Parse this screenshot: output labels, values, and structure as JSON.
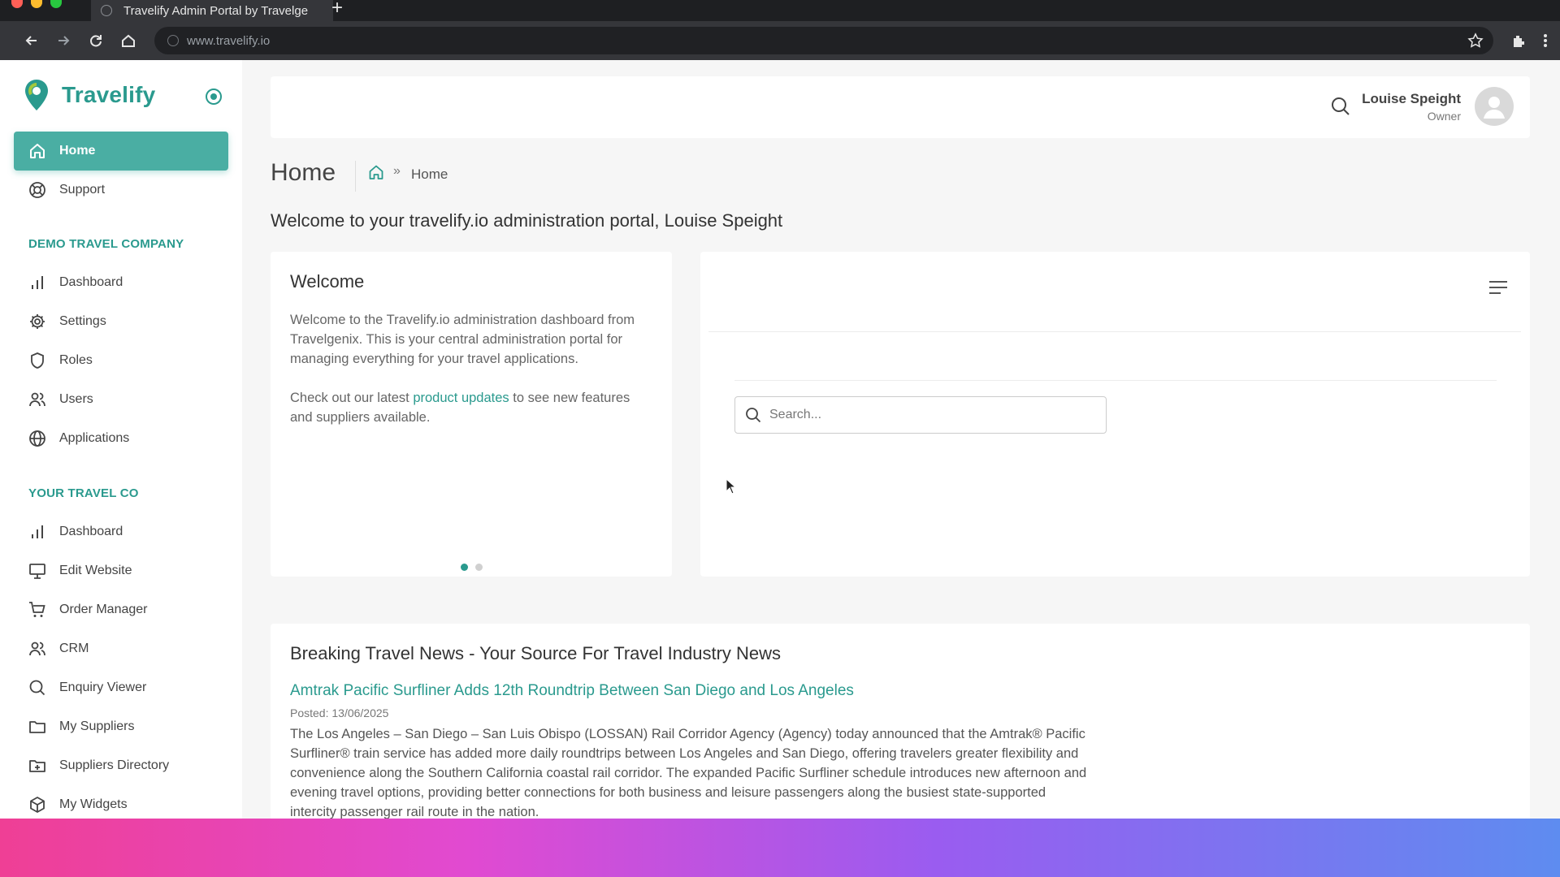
{
  "browser": {
    "tab_title": "Travelify Admin Portal by Travelge",
    "new_tab": "+",
    "url": "www.travelify.io"
  },
  "app": {
    "logo_text": "Travelify",
    "accent_color": "#2a9a8e"
  },
  "sidebar": {
    "top_items": [
      {
        "label": "Home",
        "icon": "home-icon",
        "active": true
      },
      {
        "label": "Support",
        "icon": "lifebuoy-icon"
      }
    ],
    "section1_title": "DEMO TRAVEL COMPANY",
    "section1_items": [
      {
        "label": "Dashboard",
        "icon": "bar-chart-icon"
      },
      {
        "label": "Settings",
        "icon": "gear-icon"
      },
      {
        "label": "Roles",
        "icon": "shield-icon"
      },
      {
        "label": "Users",
        "icon": "users-icon"
      },
      {
        "label": "Applications",
        "icon": "globe-icon"
      }
    ],
    "section2_title": "YOUR TRAVEL CO",
    "section2_items": [
      {
        "label": "Dashboard",
        "icon": "bar-chart-icon"
      },
      {
        "label": "Edit Website",
        "icon": "monitor-icon"
      },
      {
        "label": "Order Manager",
        "icon": "cart-icon"
      },
      {
        "label": "CRM",
        "icon": "users-icon"
      },
      {
        "label": "Enquiry Viewer",
        "icon": "search-icon"
      },
      {
        "label": "My Suppliers",
        "icon": "folder-icon"
      },
      {
        "label": "Suppliers Directory",
        "icon": "folder-plus-icon"
      },
      {
        "label": "My Widgets",
        "icon": "cube-icon"
      }
    ]
  },
  "header": {
    "user_name": "Louise Speight",
    "user_role": "Owner"
  },
  "page": {
    "title": "Home",
    "breadcrumb_sep": "»",
    "breadcrumb_current": "Home",
    "welcome_line": "Welcome to your travelify.io administration portal, Louise Speight"
  },
  "welcome_card": {
    "title": "Welcome",
    "p1": "Welcome to the Travelify.io administration dashboard from Travelgenix. This is your central administration portal for managing everything for your travel applications.",
    "p2_before": "Check out our latest ",
    "p2_link": "product updates",
    "p2_after": " to see new features and suppliers available."
  },
  "search": {
    "placeholder": "Search..."
  },
  "news": {
    "title": "Breaking Travel News - Your Source For Travel Industry News",
    "headline": "Amtrak Pacific Surfliner Adds 12th Roundtrip Between San Diego and Los Angeles",
    "posted": "Posted: 13/06/2025",
    "body": "The Los Angeles – San Diego – San Luis Obispo (LOSSAN) Rail Corridor Agency (Agency) today announced that the Amtrak® Pacific Surfliner® train service has added more daily roundtrips between Los Angeles and San Diego, offering travelers greater flexibility and convenience along the Southern California coastal rail corridor. The expanded Pacific Surfliner schedule introduces new afternoon and evening travel options, providing better connections for both business and leisure passengers along the busiest state-supported intercity passenger rail route in the nation."
  }
}
